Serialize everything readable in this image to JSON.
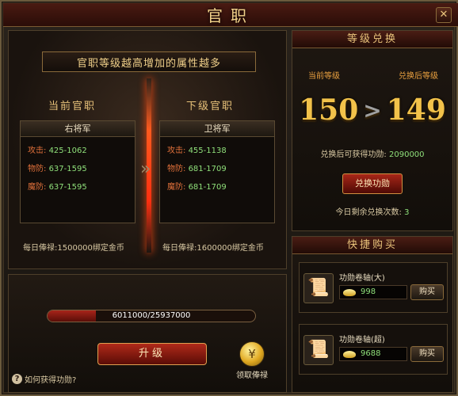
{
  "window": {
    "title": "官职",
    "close_icon": "close-icon"
  },
  "left": {
    "banner": "官职等级越高增加的属性越多",
    "current_head": "当前官职",
    "next_head": "下级官职",
    "current": {
      "rank": "右将军",
      "stats": [
        {
          "label": "攻击:",
          "value": "425-1062"
        },
        {
          "label": "物防:",
          "value": "637-1595"
        },
        {
          "label": "魔防:",
          "value": "637-1595"
        }
      ],
      "salary": "每日俸禄:1500000绑定金币"
    },
    "next": {
      "rank": "卫将军",
      "stats": [
        {
          "label": "攻击:",
          "value": "455-1138"
        },
        {
          "label": "物防:",
          "value": "681-1709"
        },
        {
          "label": "魔防:",
          "value": "681-1709"
        }
      ],
      "salary": "每日俸禄:1600000绑定金币"
    }
  },
  "bottom": {
    "progress_text": "6011000/25937000",
    "progress_fraction": 0.232,
    "upgrade_label": "升级",
    "claim_label": "领取俸禄",
    "help_text": "如何获得功勋?"
  },
  "exchange": {
    "head": "等级兑换",
    "current_label": "当前等级",
    "after_label": "兑换后等级",
    "current_level": "150",
    "after_level": "149",
    "merit_label": "兑换后可获得功勋:",
    "merit_value": "2090000",
    "button": "兑换功勋",
    "remain_label": "今日剩余兑换次数:",
    "remain_value": "3"
  },
  "shop": {
    "head": "快捷购买",
    "items": [
      {
        "name": "功勋卷轴(大)",
        "price": "998",
        "buy": "购买",
        "icon": "scroll-icon"
      },
      {
        "name": "功勋卷轴(超)",
        "price": "9688",
        "buy": "购买",
        "icon": "purple-scroll-icon"
      }
    ]
  },
  "colors": {
    "accent": "#e8c27a",
    "stat_label": "#e0703a",
    "stat_value": "#8fe07a",
    "bar_red": "#a8241a"
  }
}
